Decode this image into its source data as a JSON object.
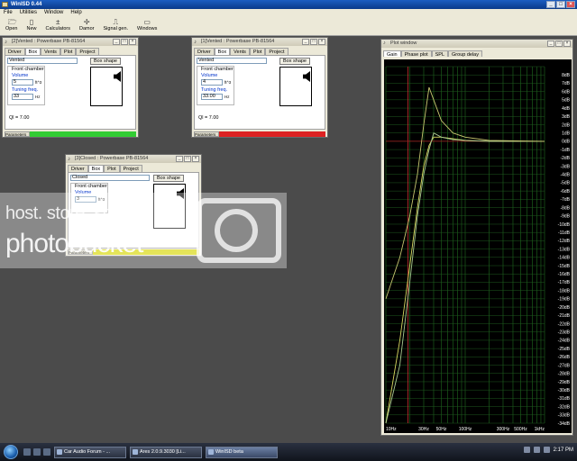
{
  "app": {
    "title": "WinISD 0.44"
  },
  "menu": [
    "File",
    "Utilities",
    "Window",
    "Help"
  ],
  "toolbar": [
    {
      "label": "Open",
      "icon": "open-folder-icon"
    },
    {
      "label": "New",
      "icon": "new-document-icon"
    },
    {
      "label": "Calculators",
      "icon": "calculator-icon"
    },
    {
      "label": "Damor",
      "icon": "damor-icon"
    },
    {
      "label": "Signal gen.",
      "icon": "signal-generator-icon"
    },
    {
      "label": "Windows",
      "icon": "windows-icon"
    }
  ],
  "window_vented2": {
    "title": "[2]Vented : Powerbase PB-81564",
    "tabs": [
      "Driver",
      "Box",
      "Vents",
      "Plot",
      "Project"
    ],
    "box_type": "Vented",
    "box_shape_button": "Box shape",
    "front_chamber_label": "Front chamber",
    "volume_label": "Volume",
    "volume_value": "5",
    "volume_unit": "ft^3",
    "tuning_label": "Tuning freq.",
    "tuning_value": "33",
    "tuning_unit": "Hz",
    "ql": "Ql = 7.00",
    "status_label": "Parameters",
    "status_color": "#33cc33"
  },
  "window_vented1": {
    "title": "[1]Vented : Powerbase PB-81564",
    "tabs": [
      "Driver",
      "Box",
      "Vents",
      "Plot",
      "Project"
    ],
    "box_type": "Vented",
    "box_shape_button": "Box shape",
    "front_chamber_label": "Front chamber",
    "volume_label": "Volume",
    "volume_value": "4",
    "volume_unit": "ft^3",
    "tuning_label": "Tuning freq.",
    "tuning_value": "33.00",
    "tuning_unit": "Hz",
    "ql": "Ql = 7.00",
    "status_label": "Parameters",
    "status_color": "#dd2222"
  },
  "window_closed3": {
    "title": "[3]Closed : Powerbase PB-81564",
    "tabs": [
      "Driver",
      "Box",
      "Plot",
      "Project"
    ],
    "box_type": "Closed",
    "box_shape_button": "Box shape",
    "front_chamber_label": "Front chamber",
    "volume_label": "Volume",
    "volume_value": "3",
    "volume_unit": "ft^3",
    "status_label": "Parameters",
    "status_color": "#d6d600"
  },
  "watermark": {
    "line1": "host. store. share.",
    "line2": "photobucket"
  },
  "plot_window": {
    "title": "Plot window",
    "tabs": [
      "Gain",
      "Phase plot",
      "SPL",
      "Group delay"
    ]
  },
  "chart_data": {
    "type": "line",
    "xlabel": "",
    "ylabel": "",
    "x_ticks": [
      "10Hz",
      "30Hz",
      "50Hz",
      "100Hz",
      "300Hz",
      "500Hz",
      "1kHz"
    ],
    "xlim": [
      10,
      1000
    ],
    "xscale": "log",
    "ylim": [
      -34,
      9
    ],
    "y_ticks": [
      "8dB",
      "7dB",
      "6dB",
      "5dB",
      "4dB",
      "3dB",
      "2dB",
      "1dB",
      "0dB",
      "-1dB",
      "-2dB",
      "-3dB",
      "-4dB",
      "-5dB",
      "-6dB",
      "-7dB",
      "-8dB",
      "-9dB",
      "-10dB",
      "-11dB",
      "-12dB",
      "-13dB",
      "-14dB",
      "-15dB",
      "-16dB",
      "-17dB",
      "-18dB",
      "-19dB",
      "-20dB",
      "-21dB",
      "-22dB",
      "-23dB",
      "-24dB",
      "-25dB",
      "-26dB",
      "-27dB",
      "-28dB",
      "-29dB",
      "-30dB",
      "-31dB",
      "-32dB",
      "-33dB",
      "-34dB"
    ],
    "grid": true,
    "series": [
      {
        "color": "#d8d860",
        "x": [
          10,
          15,
          20,
          25,
          30,
          35,
          40,
          50,
          70,
          100,
          200,
          1000
        ],
        "y": [
          -34,
          -24,
          -15,
          -8,
          -3,
          -0.5,
          0.5,
          0.5,
          0.3,
          0.1,
          0,
          0
        ]
      },
      {
        "color": "#a8c890",
        "x": [
          10,
          15,
          20,
          25,
          30,
          35,
          40,
          50,
          70,
          100,
          200,
          1000
        ],
        "y": [
          -34,
          -27,
          -17,
          -9,
          -4,
          -1,
          1,
          0.5,
          0.2,
          0.1,
          0,
          0
        ]
      },
      {
        "color": "#c8c870",
        "x": [
          10,
          15,
          20,
          25,
          30,
          35,
          40,
          50,
          70,
          100,
          200,
          1000
        ],
        "y": [
          -19,
          -14,
          -9,
          -4,
          2,
          6.5,
          5,
          2.5,
          1,
          0.5,
          0.1,
          0
        ]
      }
    ],
    "marker_lines": [
      {
        "axis": "x",
        "value": 19,
        "color": "#cc3333"
      },
      {
        "axis": "y",
        "value": 0,
        "color": "#aa2222"
      }
    ]
  },
  "taskbar": {
    "tasks": [
      "Car Audio Forum - ...",
      "Ares 2.0.9.3030 [Li...",
      "WinISD beta"
    ],
    "clock": "2:17 PM"
  }
}
